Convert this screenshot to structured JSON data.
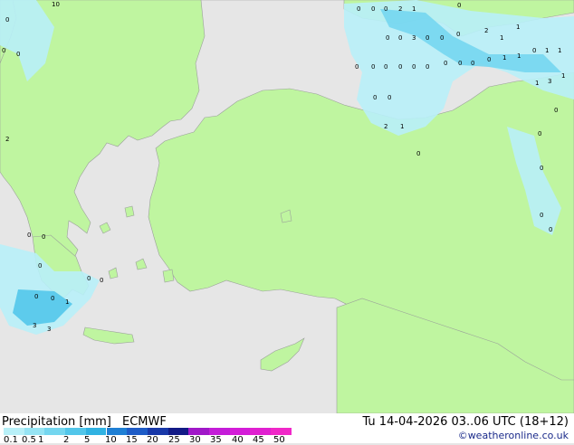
{
  "title": "Precipitation [mm]",
  "model": "ECMWF",
  "valid_time": "Tu 14-04-2026 03..06 UTC (18+12)",
  "credit": "©weatheronline.co.uk",
  "legend": {
    "labels": [
      "0.1",
      "0.5",
      "1",
      "2",
      "5",
      "10",
      "15",
      "20",
      "25",
      "30",
      "35",
      "40",
      "45",
      "50"
    ],
    "colors": [
      "#b8f0f8",
      "#96e4f4",
      "#74d6ef",
      "#52c6ea",
      "#30b2e2",
      "#1e7fd4",
      "#1d5bc6",
      "#1838a8",
      "#121a86",
      "#a018c8",
      "#c41cd8",
      "#d41cd8",
      "#e020d0",
      "#f028c8"
    ]
  },
  "point_values": [
    "10",
    "0",
    "0",
    "2",
    "1",
    "0",
    "0",
    "0",
    "0",
    "0",
    "0",
    "0",
    "3",
    "0",
    "0",
    "0",
    "2",
    "1",
    "1",
    "0",
    "0",
    "0",
    "0",
    "0",
    "0",
    "0",
    "0",
    "0",
    "0",
    "1",
    "1",
    "0",
    "1",
    "1",
    "1",
    "3",
    "1",
    "0",
    "0",
    "2",
    "1",
    "0",
    "0",
    "2",
    "0",
    "0",
    "0",
    "0",
    "0",
    "1",
    "3",
    "3",
    "0",
    "0",
    "0",
    "0",
    "0",
    "0"
  ],
  "colors": {
    "land": "#bff5a0",
    "sea": "#e6e6e6",
    "precip_light": "#b8f0f8",
    "precip_mid": "#74d6ef",
    "precip_strong": "#30b2e2"
  }
}
